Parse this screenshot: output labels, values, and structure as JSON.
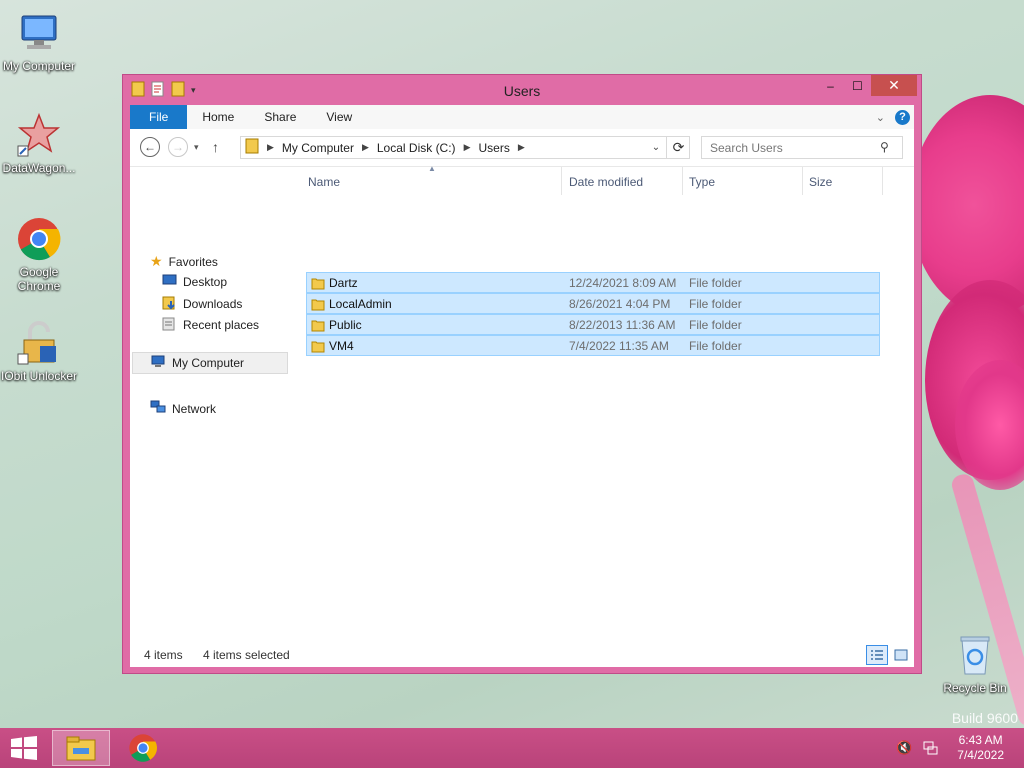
{
  "desktop": {
    "icons": [
      {
        "label": "My Computer"
      },
      {
        "label": "DataWagon..."
      },
      {
        "label": "Google Chrome"
      },
      {
        "label": "IObit Unlocker"
      },
      {
        "label": "Recycle Bin"
      }
    ],
    "build_text": "Build 9600"
  },
  "window": {
    "title": "Users",
    "controls": {
      "minimize": "–",
      "maximize": "☐",
      "close": "✕"
    },
    "ribbon_tabs": [
      "File",
      "Home",
      "Share",
      "View"
    ],
    "address": {
      "crumbs": [
        "My Computer",
        "Local Disk (C:)",
        "Users"
      ]
    },
    "search": {
      "placeholder": "Search Users"
    },
    "nav": {
      "favorites": "Favorites",
      "desktop": "Desktop",
      "downloads": "Downloads",
      "recent": "Recent places",
      "my_computer": "My Computer",
      "network": "Network"
    },
    "columns": [
      "Name",
      "Date modified",
      "Type",
      "Size"
    ],
    "rows": [
      {
        "name": "Dartz",
        "date": "12/24/2021 8:09 AM",
        "type": "File folder"
      },
      {
        "name": "LocalAdmin",
        "date": "8/26/2021 4:04 PM",
        "type": "File folder"
      },
      {
        "name": "Public",
        "date": "8/22/2013 11:36 AM",
        "type": "File folder"
      },
      {
        "name": "VM4",
        "date": "7/4/2022 11:35 AM",
        "type": "File folder"
      }
    ],
    "status": {
      "items": "4 items",
      "selected": "4 items selected"
    }
  },
  "taskbar": {
    "time": "6:43 AM",
    "date": "7/4/2022"
  },
  "colors": {
    "window_frame": "#e06ca6",
    "file_tab": "#1979ca",
    "selection": "#cde8ff",
    "taskbar": "#c94f86"
  }
}
